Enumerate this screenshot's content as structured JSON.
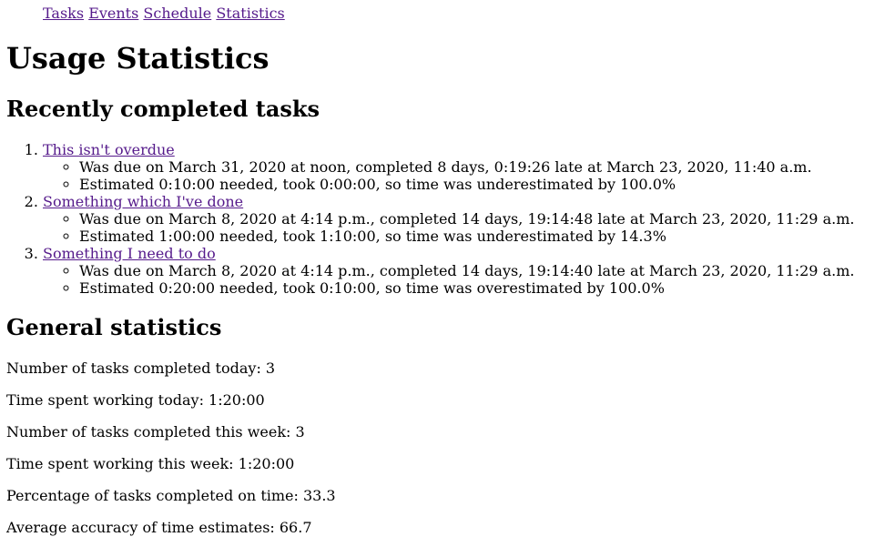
{
  "nav": {
    "tasks": "Tasks",
    "events": "Events",
    "schedule": "Schedule",
    "statistics": "Statistics"
  },
  "page_title": "Usage Statistics",
  "recent": {
    "heading": "Recently completed tasks",
    "tasks": [
      {
        "title": "This isn't overdue",
        "due": "Was due on March 31, 2020 at noon, completed 8 days, 0:19:26 late at March 23, 2020, 11:40 a.m.",
        "estimate": "Estimated 0:10:00 needed, took 0:00:00, so time was underestimated by 100.0%"
      },
      {
        "title": "Something which I've done",
        "due": "Was due on March 8, 2020 at 4:14 p.m., completed 14 days, 19:14:48 late at March 23, 2020, 11:29 a.m.",
        "estimate": "Estimated 1:00:00 needed, took 1:10:00, so time was underestimated by 14.3%"
      },
      {
        "title": "Something I need to do",
        "due": "Was due on March 8, 2020 at 4:14 p.m., completed 14 days, 19:14:40 late at March 23, 2020, 11:29 a.m.",
        "estimate": "Estimated 0:20:00 needed, took 0:10:00, so time was overestimated by 100.0%"
      }
    ]
  },
  "general": {
    "heading": "General statistics",
    "stats": [
      "Number of tasks completed today: 3",
      "Time spent working today: 1:20:00",
      "Number of tasks completed this week: 3",
      "Time spent working this week: 1:20:00",
      "Percentage of tasks completed on time: 33.3",
      "Average accuracy of time estimates: 66.7"
    ]
  },
  "colors": {
    "link_visited": "#551a8b",
    "text": "#000000",
    "background": "#ffffff"
  }
}
